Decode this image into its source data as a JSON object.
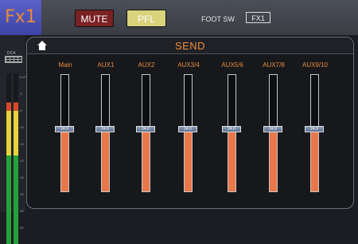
{
  "header": {
    "fx_title": "Fx1",
    "mute_label": "MUTE",
    "pfl_label": "PFL",
    "footsw_label": "FOOT SW",
    "footsw_value": "FX1"
  },
  "left_panel": {
    "dca_label": "DCA",
    "meter_scale": [
      "CLIP",
      "-3",
      "-6",
      "-10",
      "-16",
      "-20",
      "-30",
      "-40",
      "-50",
      "-60"
    ],
    "meter_level_fraction": 0.83
  },
  "send": {
    "title": "SEND",
    "faders": [
      {
        "label": "Main",
        "value": "24.0",
        "level": 0.52
      },
      {
        "label": "AUX1",
        "value": "24.0",
        "level": 0.52
      },
      {
        "label": "AUX2",
        "value": "24.0",
        "level": 0.52
      },
      {
        "label": "AUX3/4",
        "value": "24.0",
        "level": 0.52
      },
      {
        "label": "AUX5/6",
        "value": "24.0",
        "level": 0.52
      },
      {
        "label": "AUX7/8",
        "value": "24.0",
        "level": 0.52
      },
      {
        "label": "AUX9/10",
        "value": "24.0",
        "level": 0.52
      }
    ]
  },
  "colors": {
    "accent": "#f28d3a",
    "fader_fill": "#e8784a",
    "mute": "#7a2124",
    "pfl": "#d9d37c",
    "fx_title_bg": "#4a51b8"
  }
}
